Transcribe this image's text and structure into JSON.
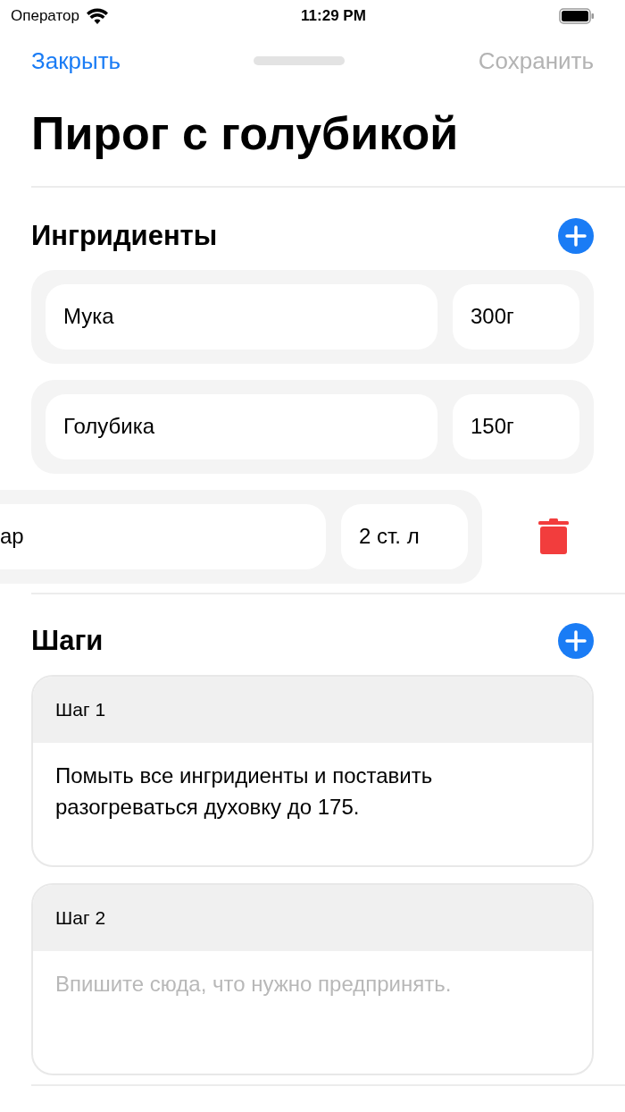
{
  "status_bar": {
    "carrier": "Оператор",
    "time": "11:29 PM"
  },
  "nav": {
    "close": "Закрыть",
    "save": "Сохранить",
    "save_disabled": true
  },
  "title": "Пирог с голубикой",
  "ingredients": {
    "heading": "Ингридиенты",
    "items": [
      {
        "name": "Мука",
        "amount": "300г",
        "swiped": false
      },
      {
        "name": "Голубика",
        "amount": "150г",
        "swiped": false
      },
      {
        "name": "ар",
        "amount": "2 ст. л",
        "swiped": true
      }
    ]
  },
  "steps": {
    "heading": "Шаги",
    "items": [
      {
        "title": "Шаг 1",
        "text": "Помыть все ингридиенты и поставить разогреваться духовку до 175."
      },
      {
        "title": "Шаг 2",
        "placeholder": "Впишите сюда, что нужно предпринять."
      }
    ]
  }
}
